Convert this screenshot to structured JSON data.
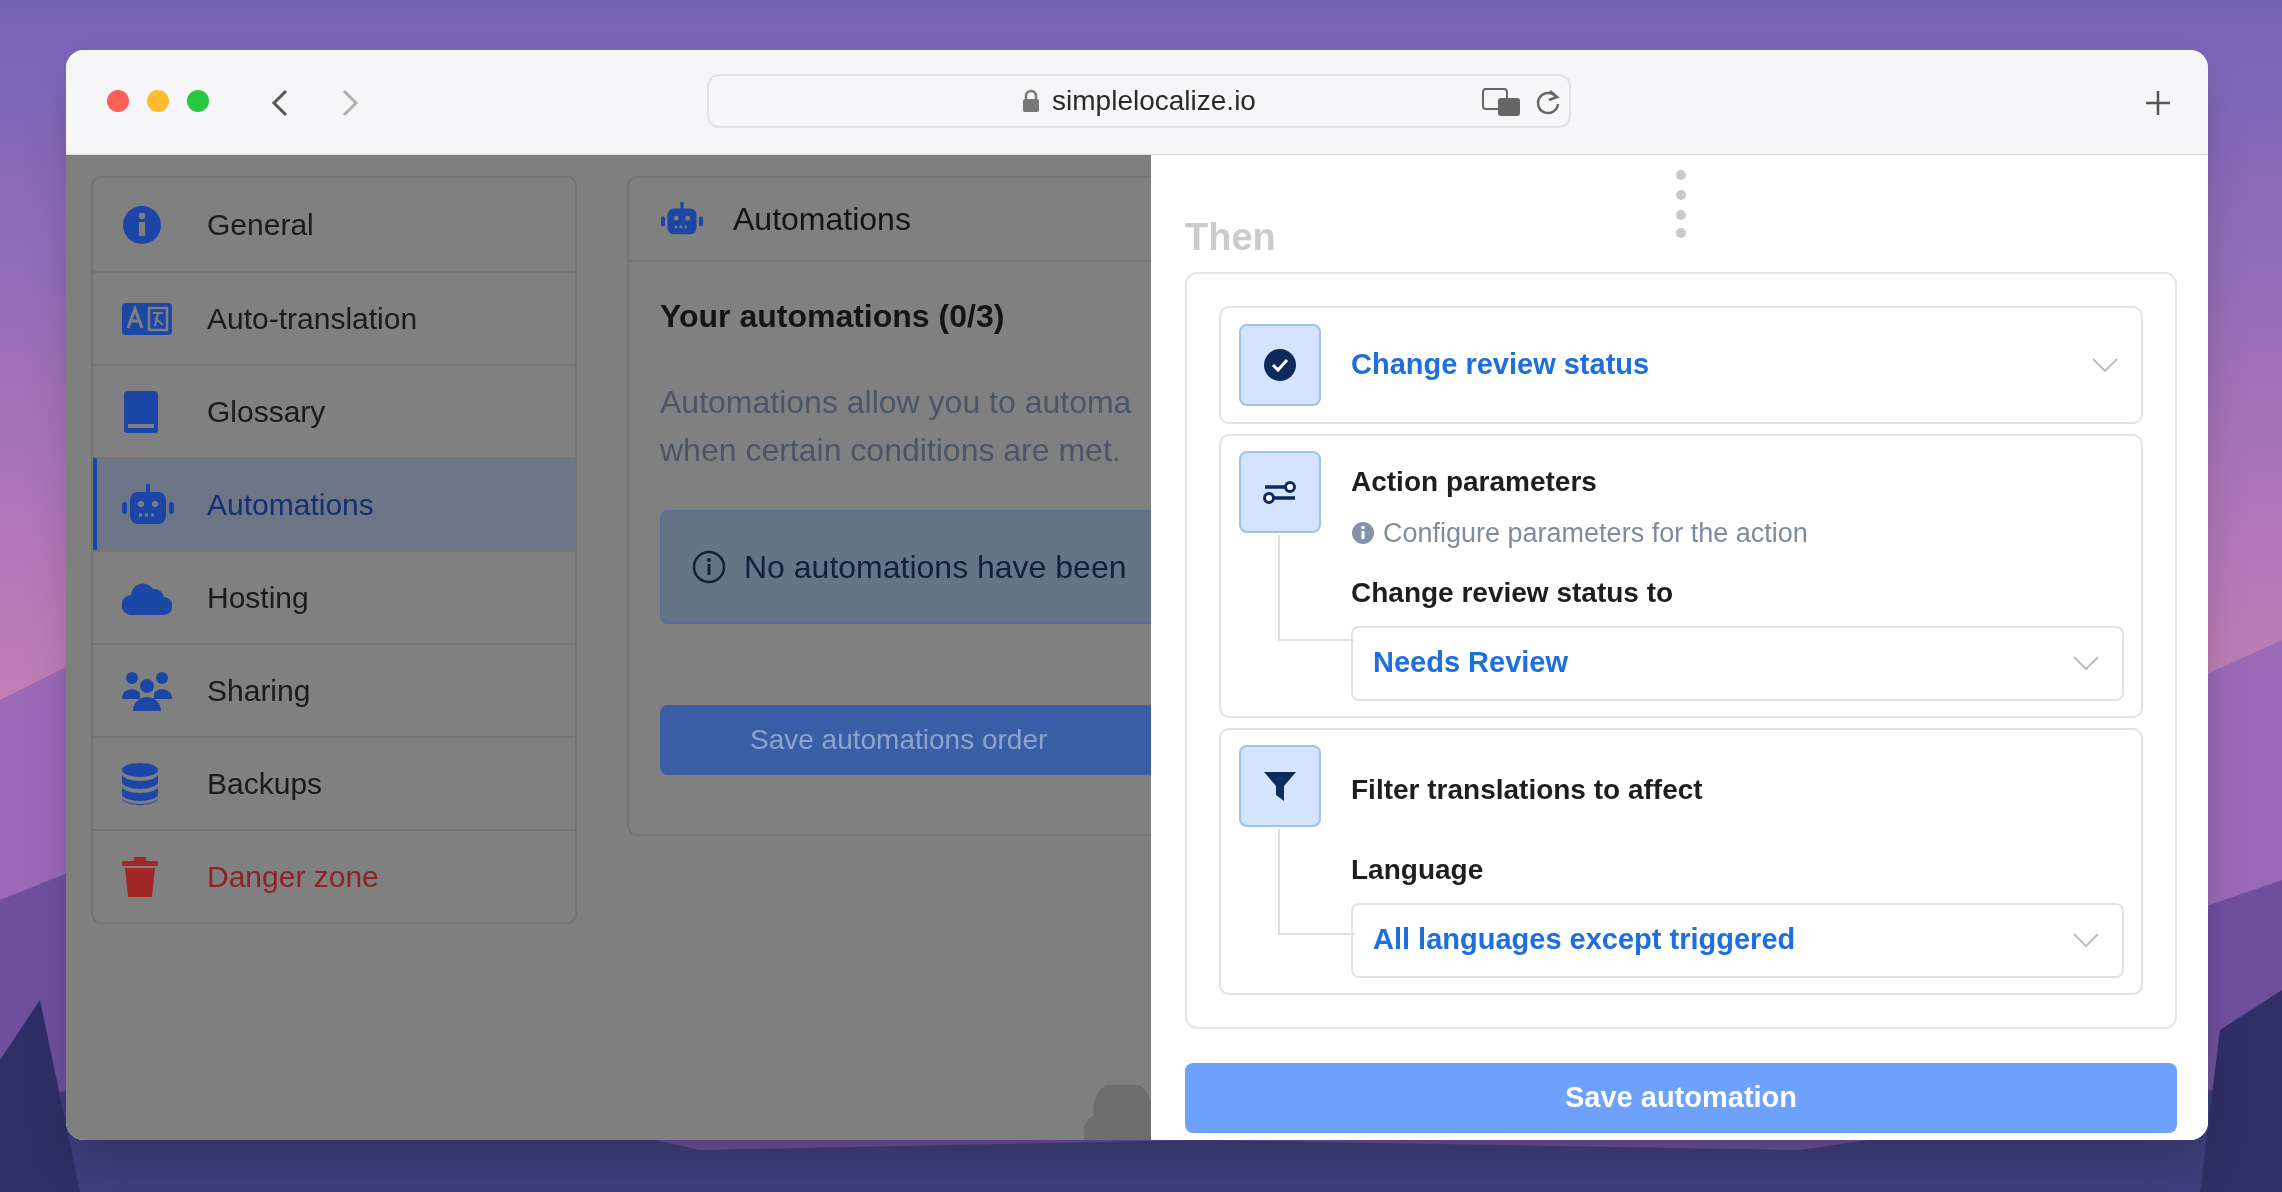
{
  "browser": {
    "url": "simplelocalize.io"
  },
  "sidebar": {
    "items": [
      {
        "label": "General",
        "selected": false,
        "kind": "normal"
      },
      {
        "label": "Auto-translation",
        "selected": false,
        "kind": "normal"
      },
      {
        "label": "Glossary",
        "selected": false,
        "kind": "normal"
      },
      {
        "label": "Automations",
        "selected": true,
        "kind": "normal"
      },
      {
        "label": "Hosting",
        "selected": false,
        "kind": "normal"
      },
      {
        "label": "Sharing",
        "selected": false,
        "kind": "normal"
      },
      {
        "label": "Backups",
        "selected": false,
        "kind": "normal"
      },
      {
        "label": "Danger zone",
        "selected": false,
        "kind": "danger"
      }
    ]
  },
  "main": {
    "title": "Automations",
    "heading": "Your automations (0/3)",
    "description_lines": [
      "Automations allow you to automa",
      "when certain conditions are met."
    ],
    "notice": "No automations have been",
    "button": "Save automations order"
  },
  "panel": {
    "section": "Then",
    "steps": [
      {
        "kind": "action",
        "title": "Change review status"
      },
      {
        "kind": "params",
        "title": "Action parameters",
        "hint": "Configure parameters for the action",
        "field_label": "Change review status to",
        "value": "Needs Review"
      },
      {
        "kind": "filter",
        "title": "Filter translations to affect",
        "field_label": "Language",
        "value": "All languages except triggered"
      }
    ],
    "save": "Save automation"
  }
}
